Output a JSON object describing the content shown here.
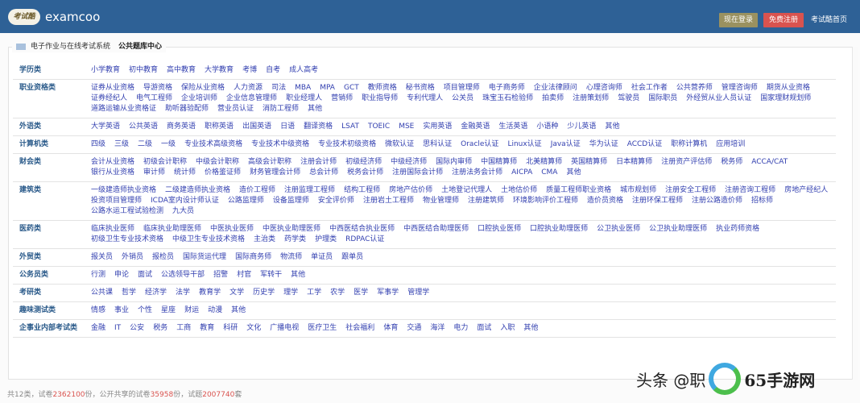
{
  "header": {
    "logo_text": "考试酷",
    "brand": "examcoo",
    "login_label": "现在登录",
    "register_label": "免费注册",
    "home_label": "考试酷首页",
    "colors": {
      "bar": "#2e6196",
      "login": "#9a9160",
      "register": "#d9534f"
    }
  },
  "legend": {
    "system": "电子作业与在线考试系统",
    "title": "公共题库中心"
  },
  "categories": [
    {
      "name": "学历类",
      "items": [
        "小学教育",
        "初中教育",
        "高中教育",
        "大学教育",
        "考博",
        "自考",
        "成人高考"
      ]
    },
    {
      "name": "职业资格类",
      "items": [
        "证券从业资格",
        "导游资格",
        "保险从业资格",
        "人力资源",
        "司法",
        "MBA",
        "MPA",
        "GCT",
        "教师资格",
        "秘书资格",
        "项目管理师",
        "电子商务师",
        "企业法律顾问",
        "心理咨询师",
        "社会工作者",
        "公共营养师",
        "管理咨询师",
        "期货从业资格",
        "证券经纪人",
        "电气工程师",
        "企业培训师",
        "企业信息管理师",
        "职业经理人",
        "营销师",
        "职业指导师",
        "专利代理人",
        "公关员",
        "珠宝玉石检验师",
        "拍卖师",
        "注册策划师",
        "驾驶员",
        "国际职员",
        "外经贸从业人员认证",
        "国家理财规划师",
        "道路运输从业资格证",
        "助听器验配师",
        "营业员认证",
        "消防工程师",
        "其他"
      ]
    },
    {
      "name": "外语类",
      "items": [
        "大学英语",
        "公共英语",
        "商务英语",
        "职称英语",
        "出国英语",
        "日语",
        "翻译资格",
        "LSAT",
        "TOEIC",
        "MSE",
        "实用英语",
        "金融英语",
        "生活英语",
        "小语种",
        "少儿英语",
        "其他"
      ]
    },
    {
      "name": "计算机类",
      "items": [
        "四级",
        "三级",
        "二级",
        "一级",
        "专业技术高级资格",
        "专业技术中级资格",
        "专业技术初级资格",
        "微软认证",
        "思科认证",
        "Oracle认证",
        "Linux认证",
        "Java认证",
        "华为认证",
        "ACCD认证",
        "职称计算机",
        "应用培训"
      ]
    },
    {
      "name": "财会类",
      "items": [
        "会计从业资格",
        "初级会计职称",
        "中级会计职称",
        "高级会计职称",
        "注册会计师",
        "初级经济师",
        "中级经济师",
        "国际内审师",
        "中国精算师",
        "北美精算师",
        "英国精算师",
        "日本精算师",
        "注册资产评估师",
        "税务师",
        "ACCA/CAT",
        "银行从业资格",
        "审计师",
        "统计师",
        "价格鉴证师",
        "财务管理会计师",
        "总会计师",
        "税务会计师",
        "注册国际会计师",
        "注册法务会计师",
        "AICPA",
        "CMA",
        "其他"
      ]
    },
    {
      "name": "建筑类",
      "items": [
        "一级建造师执业资格",
        "二级建造师执业资格",
        "造价工程师",
        "注册监理工程师",
        "结构工程师",
        "房地产估价师",
        "土地登记代理人",
        "土地估价师",
        "质量工程师职业资格",
        "城市规划师",
        "注册安全工程师",
        "注册咨询工程师",
        "房地产经纪人",
        "投资项目管理师",
        "ICDA室内设计师认证",
        "公路监理师",
        "设备监理师",
        "安全评价师",
        "注册岩土工程师",
        "物业管理师",
        "注册建筑师",
        "环境影响评价工程师",
        "造价员资格",
        "注册环保工程师",
        "注册公路造价师",
        "招标师",
        "公路水运工程试验检测",
        "九大员"
      ]
    },
    {
      "name": "医药类",
      "items": [
        "临床执业医师",
        "临床执业助理医师",
        "中医执业医师",
        "中医执业助理医师",
        "中西医结合执业医师",
        "中西医结合助理医师",
        "口腔执业医师",
        "口腔执业助理医师",
        "公卫执业医师",
        "公卫执业助理医师",
        "执业药师资格",
        "初级卫生专业技术资格",
        "中级卫生专业技术资格",
        "主治类",
        "药学类",
        "护理类",
        "RDPAC认证"
      ]
    },
    {
      "name": "外贸类",
      "items": [
        "报关员",
        "外销员",
        "报检员",
        "国际货运代理",
        "国际商务师",
        "物流师",
        "单证员",
        "跟单员"
      ]
    },
    {
      "name": "公务员类",
      "items": [
        "行测",
        "申论",
        "面试",
        "公选领导干部",
        "招警",
        "村官",
        "军转干",
        "其他"
      ]
    },
    {
      "name": "考研类",
      "items": [
        "公共课",
        "哲学",
        "经济学",
        "法学",
        "教育学",
        "文学",
        "历史学",
        "理学",
        "工学",
        "农学",
        "医学",
        "军事学",
        "管理学"
      ]
    },
    {
      "name": "趣味测试类",
      "items": [
        "情感",
        "事业",
        "个性",
        "星座",
        "财运",
        "动漫",
        "其他"
      ]
    },
    {
      "name": "企事业内部考试类",
      "items": [
        "金融",
        "IT",
        "公安",
        "税务",
        "工商",
        "教育",
        "科研",
        "文化",
        "广播电视",
        "医疗卫生",
        "社会福利",
        "体育",
        "交通",
        "海洋",
        "电力",
        "面试",
        "入职",
        "其他"
      ]
    }
  ],
  "footer": {
    "prefix": "共12类，试卷",
    "papers": "2362100",
    "mid1": "份，公开共享的试卷",
    "shared": "35958",
    "mid2": "份，试题",
    "questions": "2007740",
    "suffix": "套"
  },
  "watermark": {
    "text": "头条 @职",
    "site": "65手游网"
  }
}
